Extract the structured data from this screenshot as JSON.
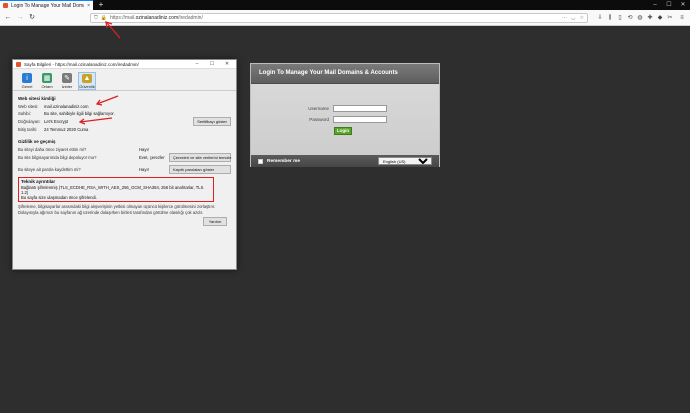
{
  "browser": {
    "tab_title": "Login To Manage Your Mail Doma",
    "url_prefix": "https://mail.",
    "url_host": "ozinalanadiniz.com",
    "url_path": "/iredadmin/",
    "new_tab": "+",
    "close_tab": "×"
  },
  "dialog": {
    "title": "Sayfa Bilgileri - https://mail.ozinalanadiniz.com/iredadmin/",
    "tabs": [
      {
        "label": "Genel",
        "color": "#2a7bd4",
        "glyph": "i"
      },
      {
        "label": "Ortam",
        "color": "#3a9a6a",
        "glyph": "▦"
      },
      {
        "label": "İzinler",
        "color": "#7a7a7a",
        "glyph": "✎"
      },
      {
        "label": "Güvenlik",
        "color": "#c9a227",
        "glyph": "🔒"
      }
    ],
    "identity": {
      "heading": "Web sitesi kimliği",
      "website_label": "Web sitesi:",
      "website_value": "mail.ozinalanadiniz.com",
      "owner_label": "Sahibi:",
      "owner_value": "Bu site, sahibiyle ilgili bilgi sağlamıyor.",
      "verifier_label": "Doğrulayan:",
      "verifier_value": "Let's Encrypt",
      "view_cert_button": "Sertifikayı göster",
      "expiry_label": "Bitiş tarihi:",
      "expiry_value": "24 Temmuz 2020 Cuma"
    },
    "privacy": {
      "heading": "Gizlilik ve geçmiş",
      "q1": "Bu siteyi daha önce ziyaret ettim mi?",
      "a1": "Hayır",
      "q2": "Bu site bilgisayarımda bilgi depoluyor mu?",
      "a2": "Evet, çerezler",
      "btn2": "Çerezleri ve site verilerini temizle",
      "q3": "Bu siteye ait parola kaydettim mi?",
      "a3": "Hayır",
      "btn3": "Kayıtlı parolaları göster"
    },
    "technical": {
      "heading": "Teknik ayrıntılar",
      "line1": "Bağlantı şifrelenmiş (TLS_ECDHE_RSA_WITH_AES_256_GCM_SHA384, 256 bit anahtarlar, TLS 1.2)",
      "line2": "Bu sayfa size ulaşmadan önce şifrelendi.",
      "note": "Şifreleme, bilgisayarlar arasındaki bilgi alışverişinin yetkisi olmayan üçüncü kişilerce görülmesini zorlaştırır. Dolayısıyla ağımızı bu sayfanın ağ üzerinde dolaşırken birileri tarafından görülme olasılığı çok azdır."
    },
    "help_button": "Yardım"
  },
  "login": {
    "title": "Login To Manage Your Mail Domains & Accounts",
    "username_label": "Username",
    "password_label": "Password",
    "login_button": "Login",
    "remember_me": "Remember me",
    "language": "English (US)"
  },
  "colors": {
    "annotation": "#e02020",
    "login_green": "#5aa52a"
  }
}
